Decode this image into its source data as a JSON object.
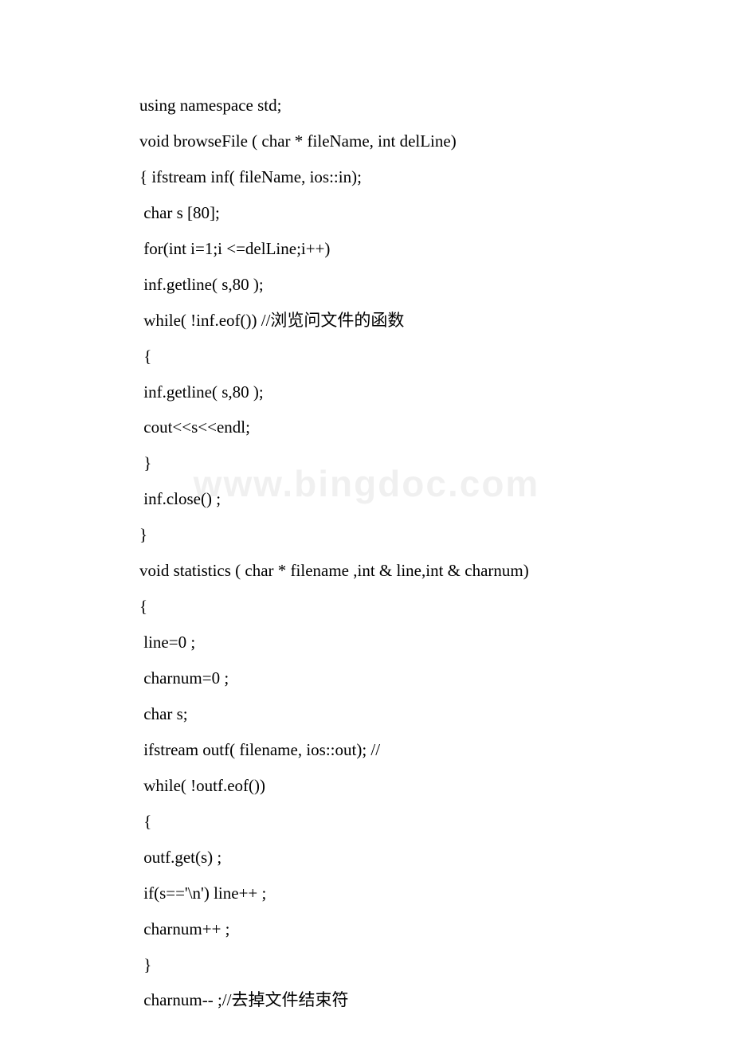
{
  "watermark": "www.bingdoc.com",
  "code": {
    "lines": [
      "using namespace std;",
      "void browseFile ( char * fileName, int delLine)",
      "{ ifstream inf( fileName, ios::in);",
      " char s [80];",
      " for(int i=1;i <=delLine;i++)",
      " inf.getline( s,80 );",
      " while( !inf.eof()) //浏览问文件的函数",
      " {",
      " inf.getline( s,80 );",
      " cout<<s<<endl;",
      " }",
      " inf.close() ;",
      "}",
      "void statistics ( char * filename ,int & line,int & charnum)",
      "{",
      " line=0 ;",
      " charnum=0 ;",
      " char s;",
      " ifstream outf( filename, ios::out); //",
      " while( !outf.eof())",
      " {",
      " outf.get(s) ;",
      " if(s=='\\n') line++ ;",
      " charnum++ ;",
      " }",
      " charnum-- ;//去掉文件结束符"
    ]
  }
}
